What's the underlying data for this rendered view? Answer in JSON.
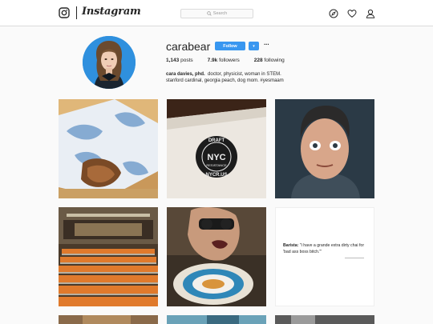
{
  "nav": {
    "wordmark": "Instagram",
    "search_placeholder": "Search"
  },
  "profile": {
    "username": "carabear",
    "follow_label": "Follow",
    "dropdown_label": "▾",
    "more_label": "···",
    "stats": {
      "posts": "1,143",
      "posts_label": " posts",
      "followers": "7.9k",
      "followers_label": " followers",
      "following": "228",
      "following_label": " following"
    },
    "bio": {
      "full_name": "cara davies, phd.",
      "line1": "doctor, physicist, woman in STEM.",
      "line2": "stanford cardinal, georgia peach, dog mom. #yesmaam"
    }
  },
  "posts": {
    "quote": {
      "speaker": "Barista:",
      "text": " \"i have a grande extra dirty chai for 'bad ass boss bitch.'\""
    },
    "sticker_top": "DRAFT",
    "sticker_mid": "NYC",
    "sticker_bottom": "NYCR.US",
    "sticker_side": "RESISTANCE"
  },
  "colors": {
    "accent": "#3897f0",
    "border": "#dbdbdb",
    "background": "#fafafa"
  },
  "icons": [
    "instagram-logo-icon",
    "search-icon",
    "compass-icon",
    "heart-icon",
    "user-icon"
  ]
}
